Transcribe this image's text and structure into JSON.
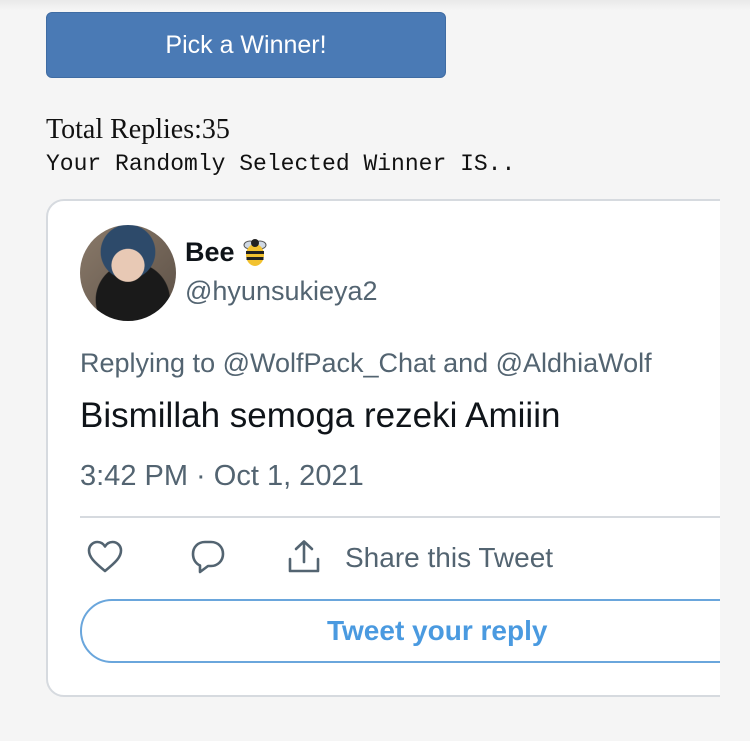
{
  "pick_button": {
    "label": "Pick a Winner!"
  },
  "summary": {
    "total_replies": "Total Replies:35",
    "selected_text": "Your Randomly Selected Winner IS.."
  },
  "tweet": {
    "display_name": "Bee",
    "name_emoji_icon": "bee-icon",
    "handle": "@hyunsukieya2",
    "replying_to": "Replying to @WolfPack_Chat and @AldhiaWolf",
    "text": "Bismillah semoga rezeki Amiiin",
    "timestamp": "3:42 PM · Oct 1, 2021",
    "actions": {
      "like_icon": "heart-icon",
      "reply_icon": "comment-icon",
      "share_icon": "share-icon",
      "share_label": "Share this Tweet"
    },
    "reply_button_label": "Tweet your reply"
  },
  "colors": {
    "button_bg": "#4a7ab5",
    "link_blue": "#4a9ae0",
    "secondary_text": "#536471",
    "page_bg": "#f5f5f5"
  }
}
